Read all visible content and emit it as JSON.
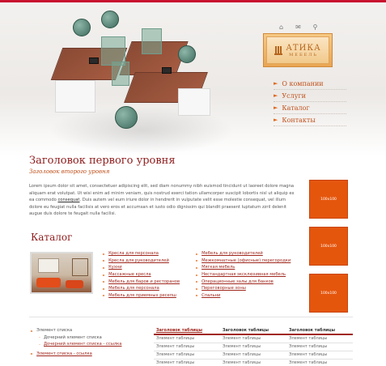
{
  "header": {
    "icons": [
      "home-icon",
      "mail-icon",
      "search-icon"
    ],
    "logo": {
      "title": "АТИКА",
      "subtitle": "МЕБЕЛЬ"
    }
  },
  "nav": {
    "items": [
      {
        "label": "О компании"
      },
      {
        "label": "Услуги"
      },
      {
        "label": "Каталог"
      },
      {
        "label": "Контакты"
      }
    ]
  },
  "content": {
    "title": "Заголовок первого уровня",
    "subtitle": "Заголовок второго уровня",
    "paragraph_part1": "Lorem ipsum dolor sit amet, consectetuer adipiscing elit, sed diam nonummy nibh euismod tincidunt ut laoreet dolore magna aliquam erat volutpat. Ut wisi enim ad minim veniam, quis nostrud exerci tation ullamcorper suscipit lobortis nisl ut aliquip ex ea commodo ",
    "paragraph_link": "consequat",
    "paragraph_part2": ". Duis autem vel eum iriure dolor in hendrerit in vulputate velit esse molestie consequat, vel illum dolore eu feugiat nulla facilisis at vero eros et accumsan et iusto odio dignissim qui blandit praesent luptatum zzril delenit augue duis dolore te feugait nulla facilisi."
  },
  "ads": [
    {
      "label": "100x100"
    },
    {
      "label": "100x100"
    },
    {
      "label": "100x100"
    }
  ],
  "catalog": {
    "title": "Каталог",
    "col1": [
      "Кресла для персонала",
      "Кресла для руководителей",
      "Кухни",
      "Массажные кресла",
      "Мебель для баров и ресторанов",
      "Мебель для персонала",
      "Мебель для приемных ресепш"
    ],
    "col2": [
      "Мебель для руководителей",
      "Межкомнатные (офисные) перегородки",
      "Мягкая мебель",
      "Нестандартная эксклюзивная мебель",
      "Операционные залы для банков",
      "Переговорные зоны",
      "Спальни"
    ]
  },
  "side_list": {
    "item": "Элемент списка",
    "sub1": "Дочерний элемент списка",
    "sub2": "Дочерний элемент списка - ссылка",
    "link": "Элемент списка - ссылка"
  },
  "table": {
    "headers": [
      "Заголовок таблицы",
      "Заголовок таблицы",
      "Заголовок таблицы"
    ],
    "rows": [
      [
        "Элемент таблицы",
        "Элемент таблицы",
        "Элемент таблицы"
      ],
      [
        "Элемент таблицы",
        "Элемент таблицы",
        "Элемент таблицы"
      ],
      [
        "Элемент таблицы",
        "Элемент таблицы",
        "Элемент таблицы"
      ],
      [
        "Элемент таблицы",
        "Элемент таблицы",
        "Элемент таблицы"
      ]
    ]
  },
  "colors": {
    "brand_red": "#8e1b1b",
    "accent_orange": "#e5560d",
    "link": "#a0281e"
  }
}
